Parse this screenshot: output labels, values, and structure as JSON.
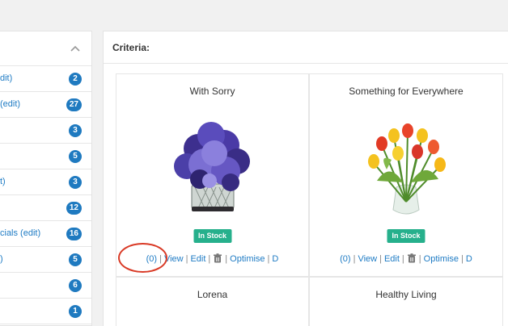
{
  "sidebar": {
    "rows": [
      {
        "label": "dit)",
        "count": "2"
      },
      {
        "label": "(edit)",
        "count": "27"
      },
      {
        "label": "",
        "count": "3"
      },
      {
        "label": "",
        "count": "5"
      },
      {
        "label": "t)",
        "count": "3"
      },
      {
        "label": "",
        "count": "12"
      },
      {
        "label": "cials (edit)",
        "count": "16"
      },
      {
        "label": ")",
        "count": "5"
      },
      {
        "label": "",
        "count": "6"
      },
      {
        "label": "",
        "count": "1"
      }
    ]
  },
  "main": {
    "title": "Criteria:"
  },
  "products": [
    {
      "title": "With Sorry",
      "stock": "In Stock",
      "actions": {
        "count": "(0)",
        "view": "View",
        "edit": "Edit",
        "optimise": "Optimise",
        "more": "D"
      }
    },
    {
      "title": "Something for Everywhere",
      "stock": "In Stock",
      "actions": {
        "count": "(0)",
        "view": "View",
        "edit": "Edit",
        "optimise": "Optimise",
        "more": "D"
      }
    },
    {
      "title": "Lorena"
    },
    {
      "title": "Healthy Living"
    }
  ],
  "colors": {
    "link": "#1e7bc4",
    "badge": "#1f7ac0",
    "stock": "#26b08c",
    "annotation": "#d93a26"
  }
}
